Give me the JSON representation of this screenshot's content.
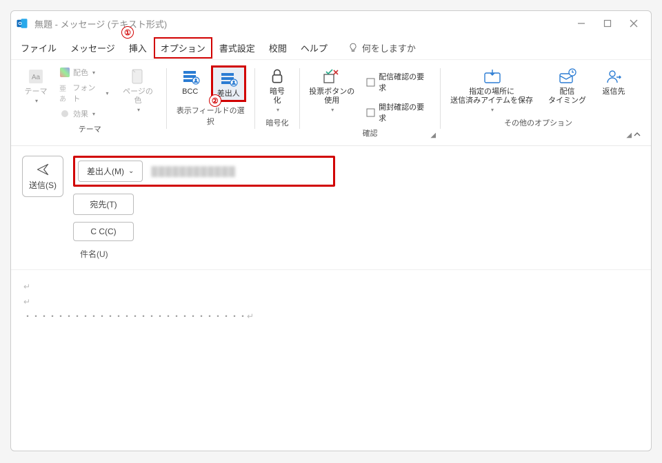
{
  "window": {
    "title": "無題 - メッセージ (テキスト形式)"
  },
  "menu": {
    "file": "ファイル",
    "message": "メッセージ",
    "insert": "挿入",
    "options": "オプション",
    "format": "書式設定",
    "review": "校閲",
    "help": "ヘルプ",
    "tellme": "何をしますか"
  },
  "callouts": {
    "one": "①",
    "two": "②"
  },
  "ribbon": {
    "theme": {
      "label": "テーマ",
      "themes": "テーマ",
      "colors": "配色",
      "fonts": "フォント",
      "effects": "効果",
      "pagecolor": "ページの色"
    },
    "fields": {
      "label": "表示フィールドの選択",
      "bcc": "BCC",
      "from": "差出人"
    },
    "encrypt": {
      "label": "暗号化",
      "button": "暗号\n化"
    },
    "confirm": {
      "label": "確認",
      "vote": "投票ボタンの\n使用",
      "delivery": "配信確認の要求",
      "read": "開封確認の要求"
    },
    "other": {
      "label": "その他のオプション",
      "saveto": "指定の場所に\n送信済みアイテムを保存",
      "timing": "配信\nタイミング",
      "replyto": "返信先"
    }
  },
  "compose": {
    "send": "送信(S)",
    "from": "差出人(M)",
    "to": "宛先(T)",
    "cc": "C C(C)",
    "subject": "件名(U)",
    "from_value": "████████████"
  },
  "body": {
    "dots": "・・・・・・・・・・・・・・・・・・・・・・・・・・・"
  }
}
